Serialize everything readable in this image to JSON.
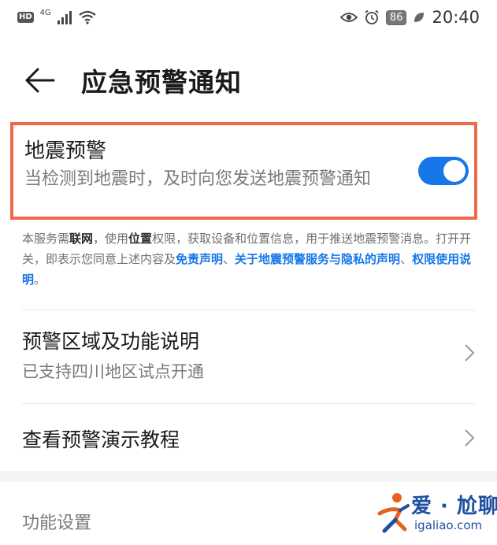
{
  "status_bar": {
    "hd_badge": "HD",
    "network": "4G",
    "battery": "86",
    "time": "20:40",
    "icons": [
      "signal-icon",
      "wifi-icon",
      "eye-icon",
      "alarm-icon",
      "battery-icon",
      "leaf-icon"
    ]
  },
  "header": {
    "title": "应急预警通知",
    "back_icon": "arrow-left-icon"
  },
  "earthquake": {
    "title": "地震预警",
    "description": "当检测到地震时，及时向您发送地震预警通知",
    "toggle_on": true,
    "toggle_color": "#1677e8",
    "highlight_color": "#ef6a4a"
  },
  "notice": {
    "p1": "本服务需",
    "b1": "联网",
    "p2": "，使用",
    "b2": "位置",
    "p3": "权限，获取设备和位置信息，用于推送地震预警消息。打开开关，即表示您同意上述内容及",
    "link1": "免责声明",
    "sep1": "、",
    "link2": "关于地震预警服务与隐私的声明",
    "sep2": "、",
    "link3": "权限使用说明",
    "end": "。"
  },
  "list": {
    "item1_title": "预警区域及功能说明",
    "item1_sub": "已支持四川地区试点开通",
    "item2_title": "查看预警演示教程",
    "chevron_icon": "chevron-right-icon"
  },
  "section_label": "功能设置",
  "watermark": {
    "line1": "爱 · 尬聊",
    "line2": "igaliao.com"
  }
}
